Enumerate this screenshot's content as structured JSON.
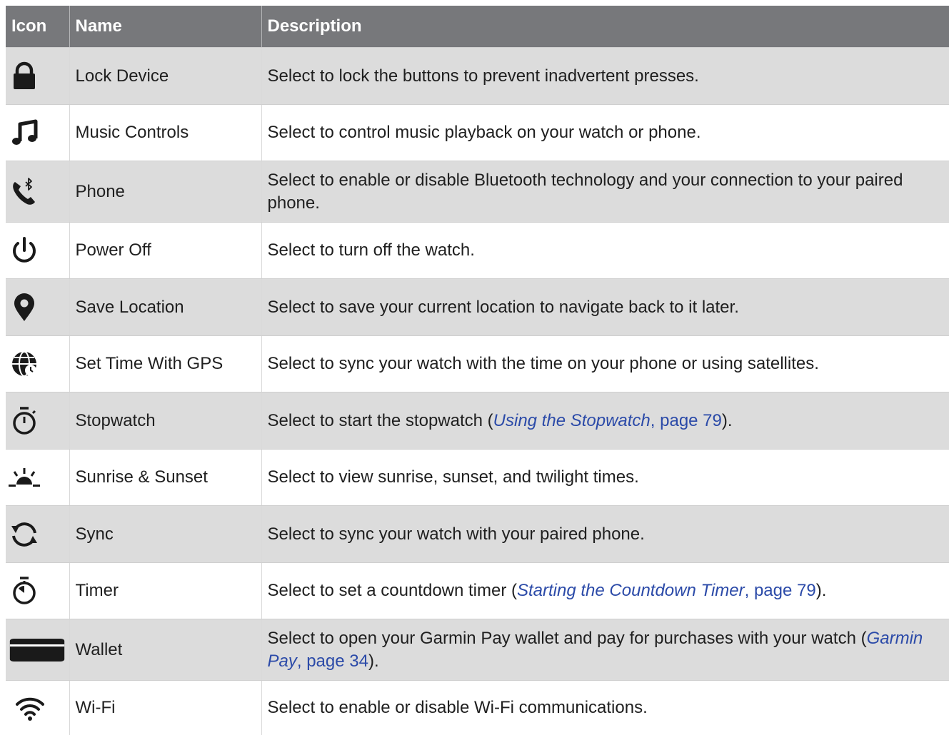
{
  "header": {
    "icon": "Icon",
    "name": "Name",
    "description": "Description"
  },
  "rows": [
    {
      "icon": "lock-icon",
      "name": "Lock Device",
      "description": "Select to lock the buttons to prevent inadvertent presses."
    },
    {
      "icon": "music-note-icon",
      "name": "Music Controls",
      "description": "Select to control music playback on your watch or phone."
    },
    {
      "icon": "phone-bluetooth-icon",
      "name": "Phone",
      "description": "Select to enable or disable Bluetooth technology and your connection to your paired phone."
    },
    {
      "icon": "power-icon",
      "name": "Power Off",
      "description": "Select to turn off the watch."
    },
    {
      "icon": "location-pin-icon",
      "name": "Save Location",
      "description": "Select to save your current location to navigate back to it later."
    },
    {
      "icon": "globe-clock-icon",
      "name": "Set Time With GPS",
      "description": "Select to sync your watch with the time on your phone or using satellites."
    },
    {
      "icon": "stopwatch-icon",
      "name": "Stopwatch",
      "description_before": "Select to start the stopwatch (",
      "link_title": "Using the Stopwatch",
      "link_page": ", page 79",
      "description_after": ")."
    },
    {
      "icon": "sunrise-icon",
      "name": "Sunrise & Sunset",
      "description": "Select to view sunrise, sunset, and twilight times."
    },
    {
      "icon": "sync-icon",
      "name": "Sync",
      "description": "Select to sync your watch with your paired phone."
    },
    {
      "icon": "timer-icon",
      "name": "Timer",
      "description_before": "Select to set a countdown timer (",
      "link_title": "Starting the Countdown Timer",
      "link_page": ", page 79",
      "description_after": ")."
    },
    {
      "icon": "wallet-icon",
      "name": "Wallet",
      "description_before": "Select to open your Garmin Pay wallet and pay for purchases with your watch (",
      "link_title": "Garmin Pay",
      "link_page": ", page 34",
      "description_after": ")."
    },
    {
      "icon": "wifi-icon",
      "name": "Wi-Fi",
      "description": "Select to enable or disable Wi-Fi communications."
    }
  ]
}
